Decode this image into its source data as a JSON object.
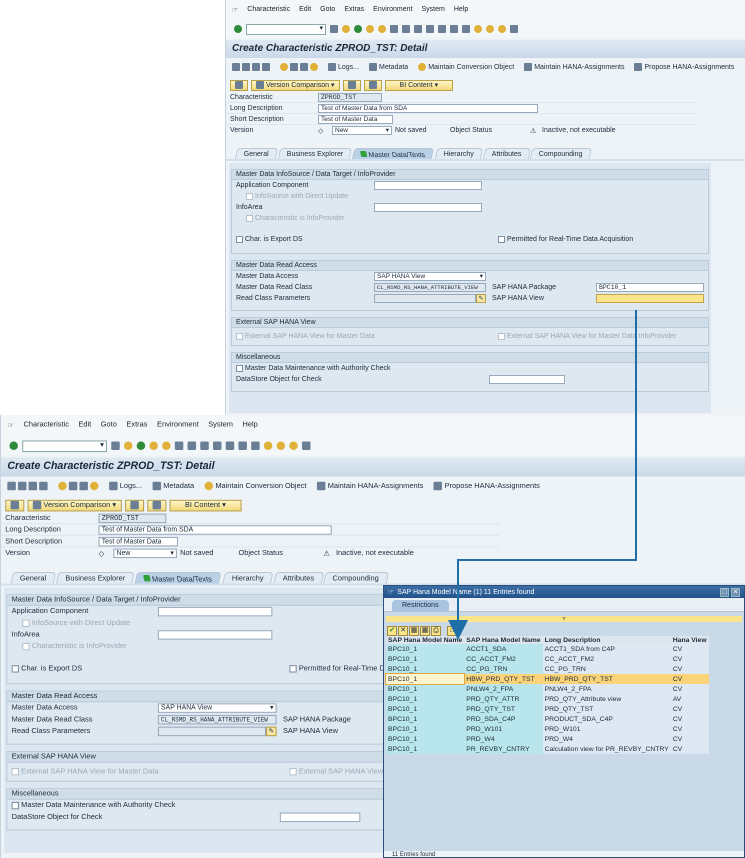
{
  "menu": [
    "Characteristic",
    "Edit",
    "Goto",
    "Extras",
    "Environment",
    "System",
    "Help"
  ],
  "title": "Create Characteristic ZPROD_TST: Detail",
  "app_toolbar": {
    "logs": "Logs...",
    "metadata": "Metadata",
    "conversion": "Maintain Conversion Object",
    "hana_assign": "Maintain HANA-Assignments",
    "propose": "Propose HANA-Assignments"
  },
  "buttons": {
    "version_comparison": "Version Comparison",
    "bi_content": "BI Content"
  },
  "header": {
    "characteristic_label": "Characteristic",
    "characteristic": "ZPROD_TST",
    "long_desc_label": "Long Description",
    "long_desc": "Test of Master Data from SDA",
    "short_desc_label": "Short Description",
    "short_desc": "Test of Master Data",
    "version_label": "Version",
    "version": "New",
    "save_status": "Not saved",
    "object_status_label": "Object Status",
    "object_status": "Inactive, not executable"
  },
  "tabs": [
    "General",
    "Business Explorer",
    "Master Data/Texts",
    "Hierarchy",
    "Attributes",
    "Compounding"
  ],
  "groups": {
    "infosource": {
      "title": "Master Data InfoSource / Data Target / InfoProvider",
      "app_component": "Application Component",
      "infosource_direct": "InfoSource with Direct Update",
      "infoarea": "InfoArea",
      "char_infoprovider": "Characteristic is InfoProvider",
      "export_ds": "Char. is Export DS",
      "realtime": "Permitted for Real-Time Data Acquisition"
    },
    "read_access": {
      "title": "Master Data Read Access",
      "access_label": "Master Data Access",
      "access": "SAP HANA View",
      "class_label": "Master Data Read Class",
      "class": "CL_RSMD_RS_HANA_ATTRIBUTE_VIEW",
      "params_label": "Read Class Parameters",
      "package_label": "SAP HANA Package",
      "package": "BPC10_1",
      "view_label": "SAP HANA View"
    },
    "external": {
      "title": "External SAP HANA View",
      "ext_master": "External SAP HANA View for Master Data",
      "ext_infoprov": "External SAP HANA View for Master Data InfoProvider"
    },
    "misc": {
      "title": "Miscellaneous",
      "auth": "Master Data Maintenance with Authority Check",
      "dso_label": "DataStore Object for Check"
    }
  },
  "popup": {
    "title": "SAP Hana Model Name (1)   11 Entries found",
    "tab": "Restrictions",
    "columns": [
      "SAP Hana Model Name",
      "SAP Hana Model Name",
      "Long Description",
      "Hana View"
    ],
    "rows": [
      [
        "BPC10_1",
        "ACCT1_SDA",
        "ACCT1_SDA from C4P",
        "CV"
      ],
      [
        "BPC10_1",
        "CC_ACCT_FM2",
        "CC_ACCT_FM2",
        "CV"
      ],
      [
        "BPC10_1",
        "CC_PG_TRN",
        "CC_PG_TRN",
        "CV"
      ],
      [
        "BPC10_1",
        "HBW_PRD_QTY_TST",
        "HBW_PRD_QTY_TST",
        "CV"
      ],
      [
        "BPC10_1",
        "PNLW4_2_FPA",
        "PNLW4_2_FPA",
        "CV"
      ],
      [
        "BPC10_1",
        "PRD_QTY_ATTR",
        "PRD_QTY_Attribute view",
        "AV"
      ],
      [
        "BPC10_1",
        "PRD_QTY_TST",
        "PRD_QTY_TST",
        "CV"
      ],
      [
        "BPC10_1",
        "PRD_SDA_C4P",
        "PRODUCT_SDA_C4P",
        "CV"
      ],
      [
        "BPC10_1",
        "PRD_W101",
        "PRD_W101",
        "CV"
      ],
      [
        "BPC10_1",
        "PRD_W4",
        "PRD_W4",
        "CV"
      ],
      [
        "BPC10_1",
        "PR_REVBY_CNTRY",
        "Calculation view for PR_REVBY_CNTRY",
        "CV"
      ]
    ],
    "selected_row": 3,
    "status": "11 Entries found"
  },
  "colors": {
    "accent": "#23528a",
    "selection": "#fbd47a",
    "input_focus": "#fbe58c",
    "arrow": "#1e6fa8"
  }
}
